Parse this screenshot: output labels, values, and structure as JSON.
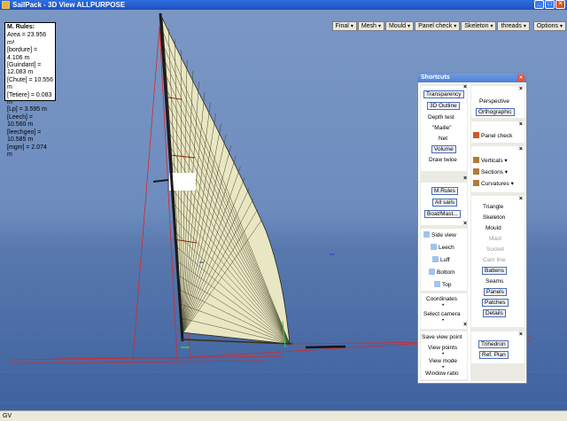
{
  "window": {
    "title": "SailPack - 3D View  ALLPURPOSE",
    "minimize": "_",
    "maximize": "□",
    "close": "✕"
  },
  "toolbar": [
    {
      "label": "Final",
      "arrow": "▾"
    },
    {
      "label": "Mesh",
      "arrow": "▾"
    },
    {
      "label": "Mould",
      "arrow": "▾"
    },
    {
      "label": "Panel check",
      "arrow": "▾"
    },
    {
      "label": "Skeleton",
      "arrow": "▾"
    },
    {
      "label": "threads",
      "arrow": "▾"
    },
    {
      "label": "Options",
      "arrow": "▾"
    }
  ],
  "mrules": {
    "title": "M. Rules:",
    "lines": [
      "Area = 23.956 m²",
      "[bordure] = 4.106 m",
      "[Guindant] = 12.083 m",
      "[Chute] = 10.556 m",
      "[Tetiere] = 0.083 m",
      "[Lp] = 3.595 m",
      "[Leech] = 10.560 m",
      "[leechgeo] = 10.585 m",
      "[mgm] = 2.074 m"
    ]
  },
  "shortcuts": {
    "title": "Shortcuts",
    "close": "✕",
    "x": "×",
    "left": {
      "display": [
        "Transparency",
        "3D Outline",
        "Depth test",
        "\"Maille\"",
        "Net",
        "Volume",
        "Draw twice"
      ],
      "info": [
        "M.Rules",
        "All sails",
        "Boat/Mast..."
      ],
      "views": [
        "Side view",
        "Leech",
        "Luff",
        "Bottom",
        "Top"
      ],
      "coordinates": "Coordinates",
      "select_camera": "Select camera",
      "save_view": "Save view point",
      "view_points": "View points",
      "view_mode": "View mode",
      "window_ratio": "Window ratio",
      "dot": "•"
    },
    "right": {
      "projection": [
        "Perspective",
        "Orthographic"
      ],
      "panel_check": "Panel check",
      "verticals": "Verticals",
      "sections": "Sections",
      "curvatures": "Curvatures",
      "dropdown_arrow": "▾",
      "display_items": [
        "Triangle",
        "Skeleton",
        "Mould",
        "Mast",
        "Socket",
        "Cam line",
        "Battens",
        "Seams",
        "Panels",
        "Patches",
        "Details"
      ],
      "trihedron": "Trihedron",
      "ref_plan": "Ref. Plan"
    }
  },
  "statusbar": {
    "text": "GV"
  },
  "colors": {
    "sky": "#7a97c4",
    "water": "#3f62a0",
    "sail": "#e9e6c3",
    "red_lines": "#d42a2a"
  }
}
